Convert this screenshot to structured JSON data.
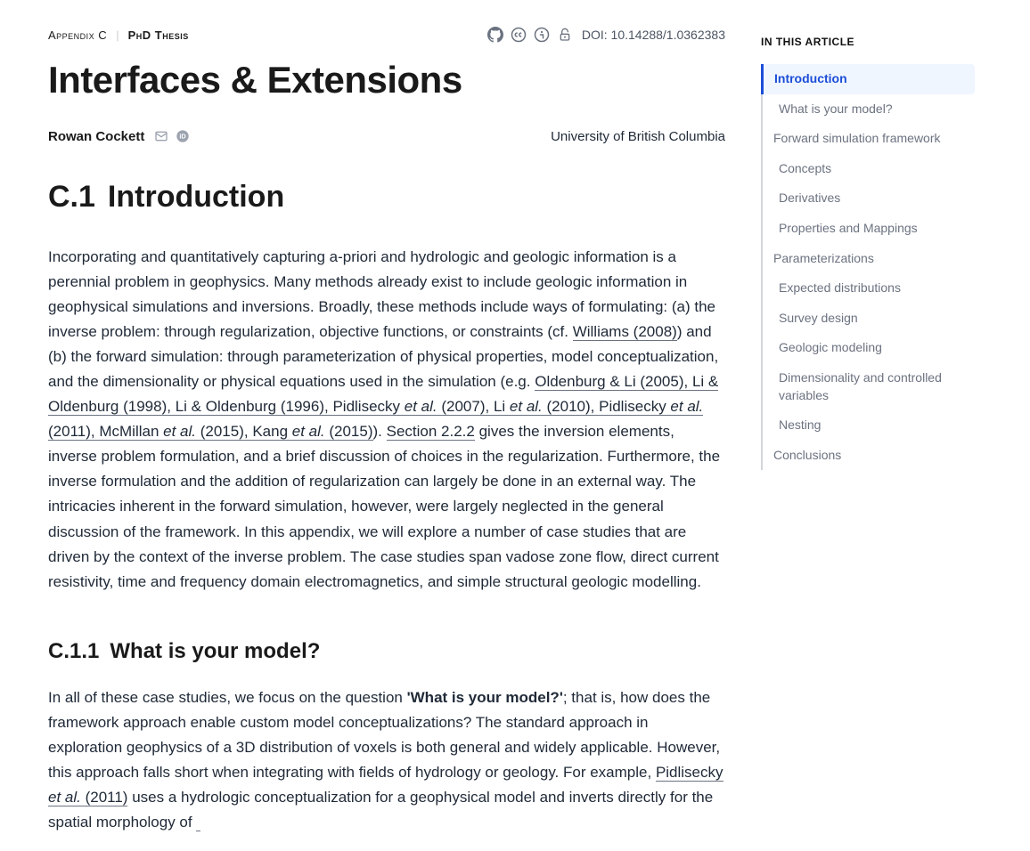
{
  "crumbs": {
    "appendix": "Appendix C",
    "thesis": "PhD Thesis",
    "doi": "DOI: 10.14288/1.0362383"
  },
  "title": "Interfaces & Extensions",
  "byline": {
    "author": "Rowan Cockett",
    "affiliation": "University of British Columbia"
  },
  "section1": {
    "num": "C.1",
    "title": "Introduction",
    "para_a": "Incorporating and quantitatively capturing a-priori and hydrologic and geologic information is a perennial problem in geophysics. Many methods already exist to include geologic information in geophysical simulations and inversions. Broadly, these methods include ways of formulating: (a) the inverse problem: through regularization, objective functions, or constraints (cf. ",
    "ref_williams": "Williams (2008)",
    "para_b": ") and (b) the forward simulation: through parameterization of physical properties, model conceptualization, and the dimensionality or physical equations used in the simulation (e.g. ",
    "ref_oldli2005": "Oldenburg & Li (2005)",
    "ref_liold1998": "Li & Oldenburg (1998)",
    "ref_liold1996": "Li & Oldenburg (1996)",
    "ref_pidlisecky2007_pre": "Pidlisecky ",
    "ref_pidlisecky2007_post": " (2007)",
    "ref_li2010_pre": "Li ",
    "ref_li2010_post": " (2010)",
    "ref_pidlisecky2011_pre": "Pidlisecky ",
    "ref_pidlisecky2011_post": " (2011)",
    "ref_mcmillan2015_pre": "McMillan ",
    "ref_mcmillan2015_post": " (2015)",
    "ref_kang2015_pre": "Kang ",
    "ref_kang2015_post": " (2015)",
    "etal": "et al.",
    "sep": ", ",
    "para_c": "). ",
    "ref_section222": "Section 2.2.2",
    "para_d": " gives the inversion elements, inverse problem formulation, and a brief discussion of choices in the regularization. Furthermore, the inverse formulation and the addition of regularization can largely be done in an external way. The intricacies inherent in the forward simulation, however, were largely neglected in the general discussion of the framework. In this appendix, we will explore a number of case studies that are driven by the context of the inverse problem. The case studies span vadose zone flow, direct current resistivity, time and frequency domain electromagnetics, and simple structural geologic modelling."
  },
  "section11": {
    "num": "C.1.1",
    "title": "What is your model?",
    "para_a": "In all of these case studies, we focus on the question ",
    "bold": "'What is your model?'",
    "para_b": "; that is, how does the framework approach enable custom model conceptualizations? The standard approach in exploration geophysics of a 3D distribution of voxels is both general and widely applicable. However, this approach falls short when integrating with fields of hydrology or geology. For example, ",
    "ref_pidlisecky2011b_pre": "Pidlisecky ",
    "ref_pidlisecky2011b_post": " (2011)",
    "para_c": " uses a hydrologic conceptualization for a geophysical model and inverts directly for the spatial morphology of"
  },
  "sidebar": {
    "heading": "IN THIS ARTICLE",
    "items": [
      {
        "label": "Introduction",
        "level": 1,
        "active": true
      },
      {
        "label": "What is your model?",
        "level": 2,
        "active": false
      },
      {
        "label": "Forward simulation framework",
        "level": 1,
        "active": false
      },
      {
        "label": "Concepts",
        "level": 2,
        "active": false
      },
      {
        "label": "Derivatives",
        "level": 2,
        "active": false
      },
      {
        "label": "Properties and Mappings",
        "level": 2,
        "active": false
      },
      {
        "label": "Parameterizations",
        "level": 1,
        "active": false
      },
      {
        "label": "Expected distributions",
        "level": 2,
        "active": false
      },
      {
        "label": "Survey design",
        "level": 2,
        "active": false
      },
      {
        "label": "Geologic modeling",
        "level": 2,
        "active": false
      },
      {
        "label": "Dimensionality and controlled variables",
        "level": 2,
        "active": false
      },
      {
        "label": "Nesting",
        "level": 2,
        "active": false
      },
      {
        "label": "Conclusions",
        "level": 1,
        "active": false
      }
    ]
  }
}
